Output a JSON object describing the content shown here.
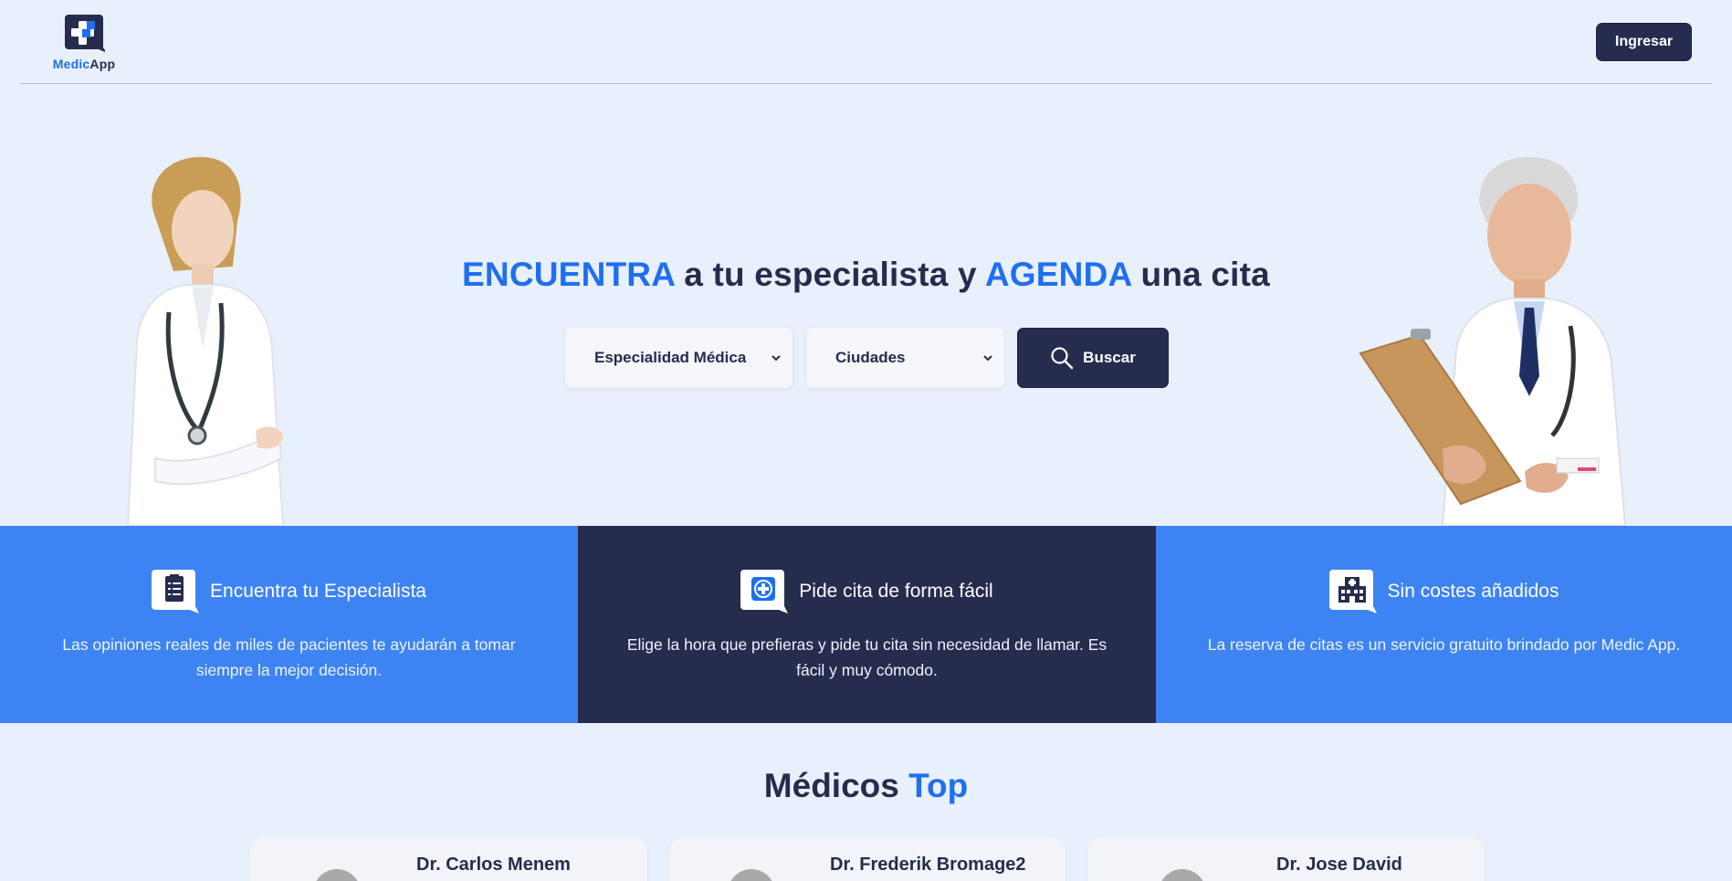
{
  "header": {
    "logo_text_a": "Medic",
    "logo_text_b": "App",
    "login_label": "Ingresar"
  },
  "hero": {
    "title_hl1": "ENCUENTRA",
    "title_mid": " a tu especialista y ",
    "title_hl2": "AGENDA",
    "title_end": " una cita",
    "specialty_selected": "Especialidad Médica",
    "city_selected": "Ciudades",
    "search_label": "Buscar"
  },
  "features": [
    {
      "icon": "clipboard-icon",
      "title": "Encuentra tu Especialista",
      "desc": "Las opiniones reales de miles de pacientes te ayudarán a tomar siempre la mejor decisión."
    },
    {
      "icon": "medical-cross-chat-icon",
      "title": "Pide cita de forma fácil",
      "desc": "Elige la hora que prefieras y pide tu cita sin necesidad de llamar. Es fácil y muy cómodo."
    },
    {
      "icon": "hospital-icon",
      "title": "Sin costes añadidos",
      "desc": "La reserva de citas es un servicio gratuito brindado por Medic App."
    }
  ],
  "top_doctors": {
    "title_a": "Médicos",
    "title_b": "Top",
    "cards": [
      {
        "name": "Dr. Carlos Menem"
      },
      {
        "name": "Dr. Frederik Bromage2"
      },
      {
        "name": "Dr. Jose David"
      }
    ]
  },
  "colors": {
    "accent": "#1f6ff0",
    "navy": "#262c4e",
    "band_blue": "#3d84f2",
    "background": "#e8f0fc"
  }
}
